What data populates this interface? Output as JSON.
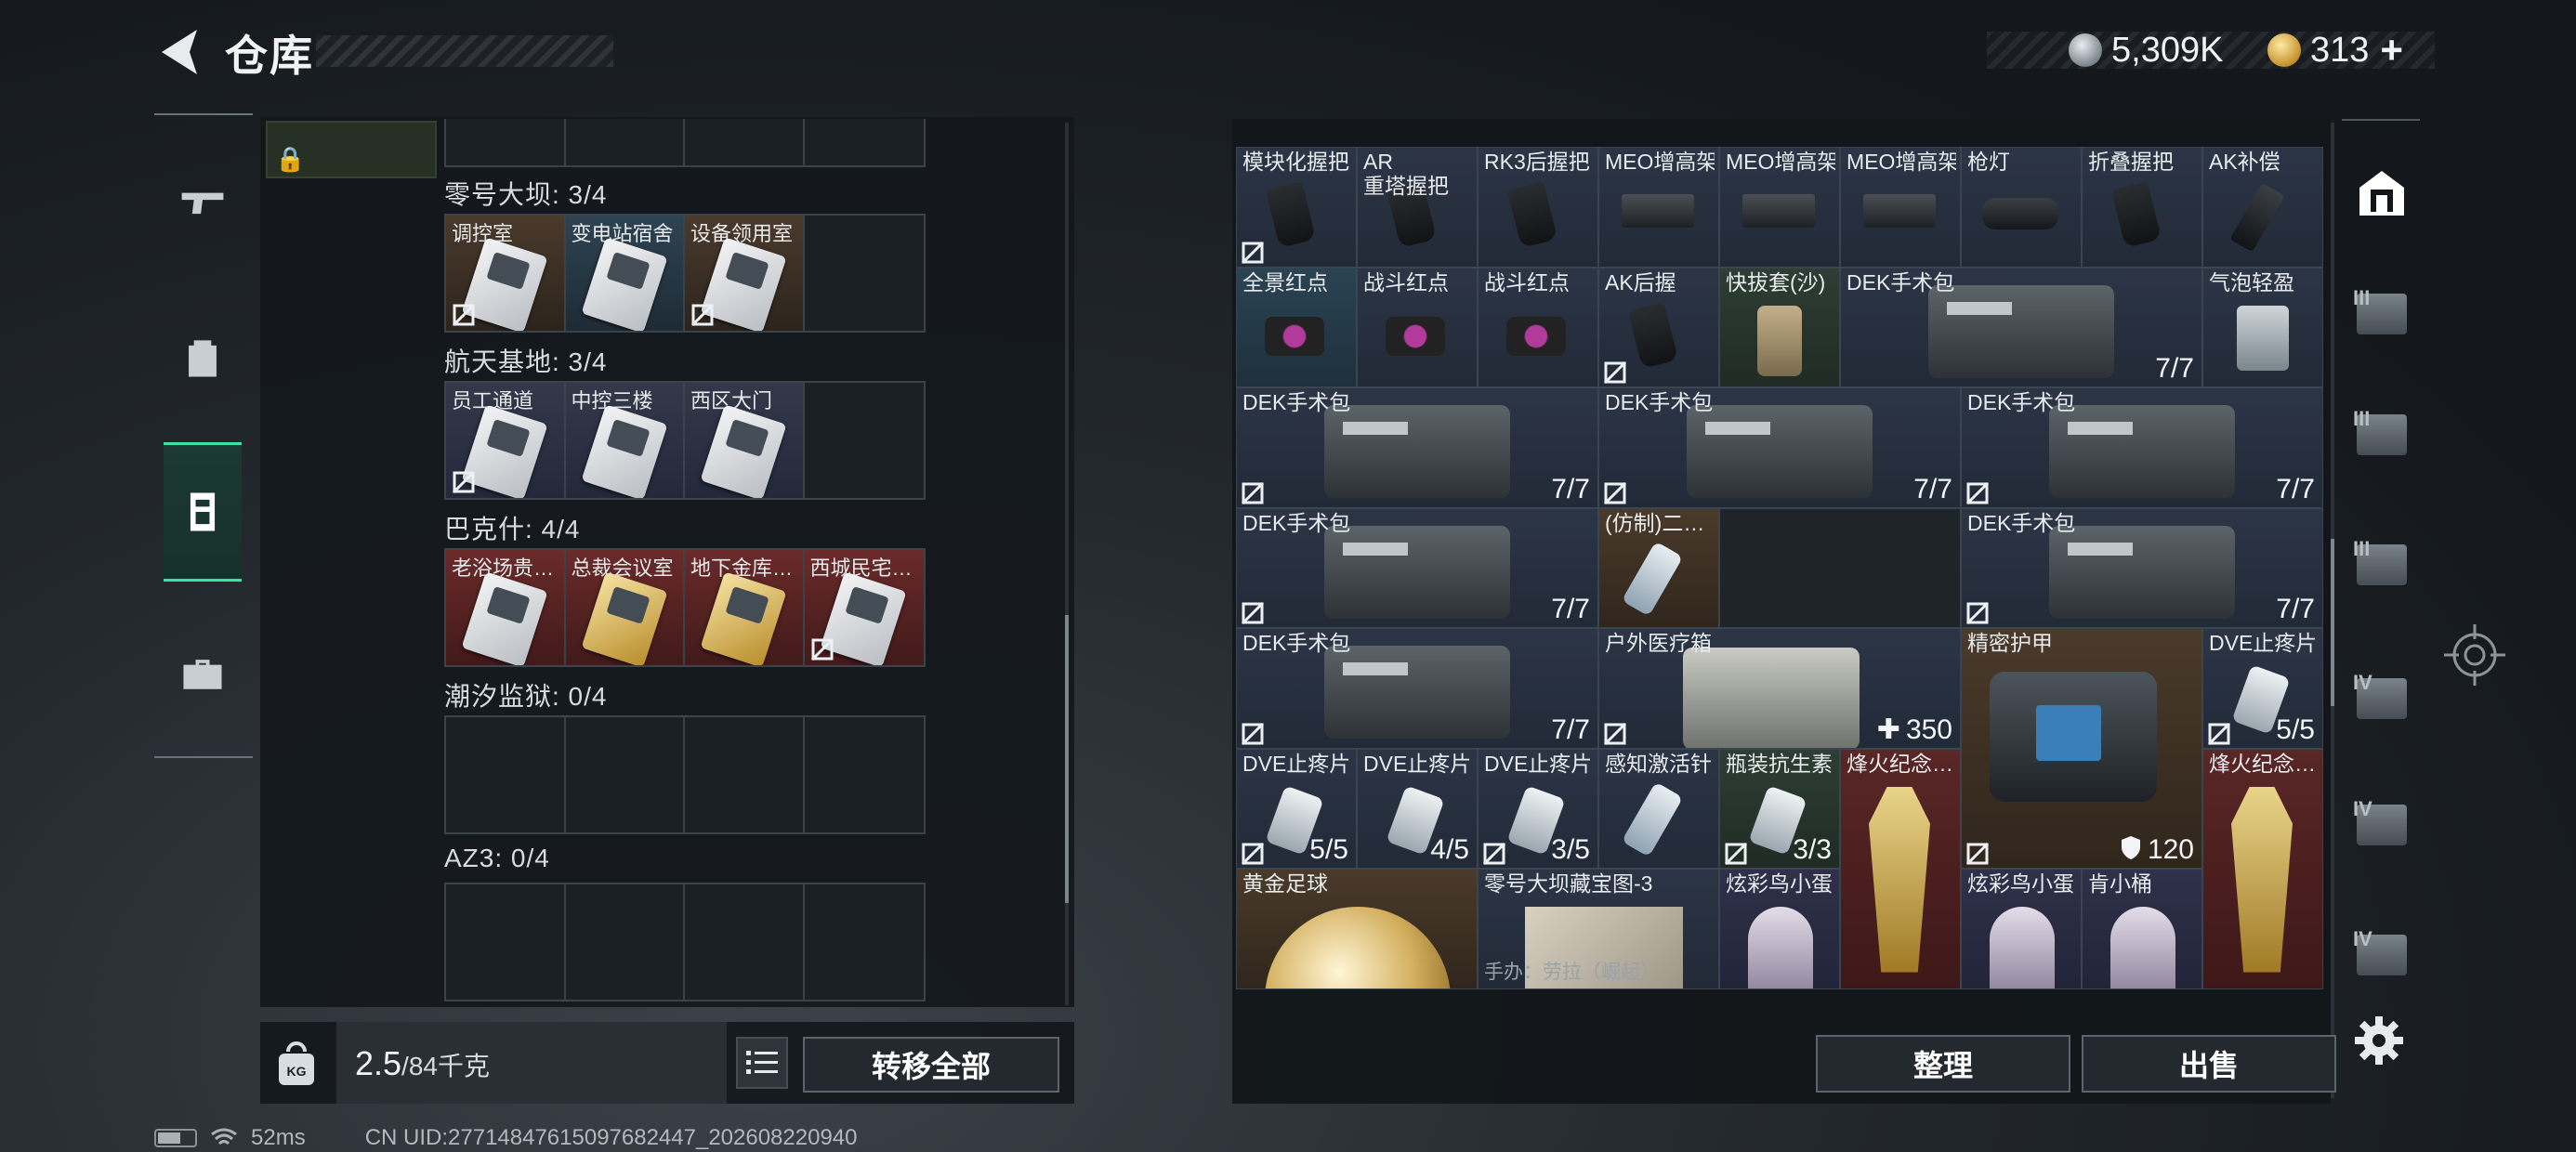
{
  "header": {
    "title": "仓库",
    "currency": {
      "silver": "5,309K",
      "gold": "313",
      "add_label": "+"
    }
  },
  "left_panel": {
    "categories": [
      {
        "label": "零号大坝: 3/4",
        "keys": [
          {
            "name": "调控室",
            "tone": "brown",
            "nosell": true
          },
          {
            "name": "变电站宿舍",
            "tone": "blue",
            "nosell": false
          },
          {
            "name": "设备领用室",
            "tone": "brown",
            "nosell": true
          },
          {
            "name": "",
            "tone": "empty",
            "nosell": false
          }
        ]
      },
      {
        "label": "航天基地: 3/4",
        "keys": [
          {
            "name": "员工通道",
            "tone": "gray",
            "nosell": true
          },
          {
            "name": "中控三楼",
            "tone": "gray",
            "nosell": false
          },
          {
            "name": "西区大门",
            "tone": "gray",
            "nosell": false
          },
          {
            "name": "",
            "tone": "empty",
            "nosell": false
          }
        ]
      },
      {
        "label": "巴克什: 4/4",
        "keys": [
          {
            "name": "老浴场贵…",
            "tone": "red",
            "nosell": false
          },
          {
            "name": "总裁会议室",
            "tone": "red-gold",
            "nosell": false
          },
          {
            "name": "地下金库…",
            "tone": "red-gold",
            "nosell": false
          },
          {
            "name": "西城民宅…",
            "tone": "red",
            "nosell": true
          }
        ]
      },
      {
        "label": "潮汐监狱: 0/4",
        "keys": []
      },
      {
        "label": "AZ3: 0/4",
        "keys": []
      }
    ]
  },
  "capacity": {
    "current": "2.5",
    "max": "/84千克"
  },
  "buttons": {
    "transfer_all": "转移全部",
    "sort": "整理",
    "sell": "出售"
  },
  "items": {
    "row1": [
      "模块化握把",
      "AR\n重塔握把",
      "RK3后握把",
      "MEO增高架",
      "MEO增高架",
      "MEO增高架",
      "枪灯",
      "折叠握把",
      "AK补偿"
    ],
    "row2": [
      "全景红点",
      "战斗红点",
      "战斗红点",
      "AK后握",
      "快拔套(沙)",
      "DEK手术包",
      "气泡轻盈"
    ],
    "dek_name": "DEK手术包",
    "dek_count": "7/7",
    "imitation": "(仿制)二…",
    "outdoor_kit": "户外医疗箱",
    "outdoor_value": "350",
    "armor": "精密护甲",
    "armor_value": "120",
    "dve": "DVE止疼片",
    "dve_counts": [
      "5/5",
      "5/5",
      "4/5",
      "3/5"
    ],
    "sense": "感知激活针",
    "antibiotic": "瓶装抗生素",
    "antibiotic_count": "3/3",
    "beacon": "烽火纪念…",
    "gold_ball": "黄金足球",
    "map": "零号大坝藏宝图-3",
    "figure_label": "手办：劳拉（崛起）",
    "bird_egg": "炫彩鸟小蛋",
    "bucket": "肯小桶"
  },
  "status": {
    "ping": "52ms",
    "uid": "CN UID:27714847615097682447_202608220940"
  },
  "colors": {
    "accent": "#3ee0a8",
    "red_key": "#6a2a2a",
    "brown_key": "#4a3a2c"
  }
}
